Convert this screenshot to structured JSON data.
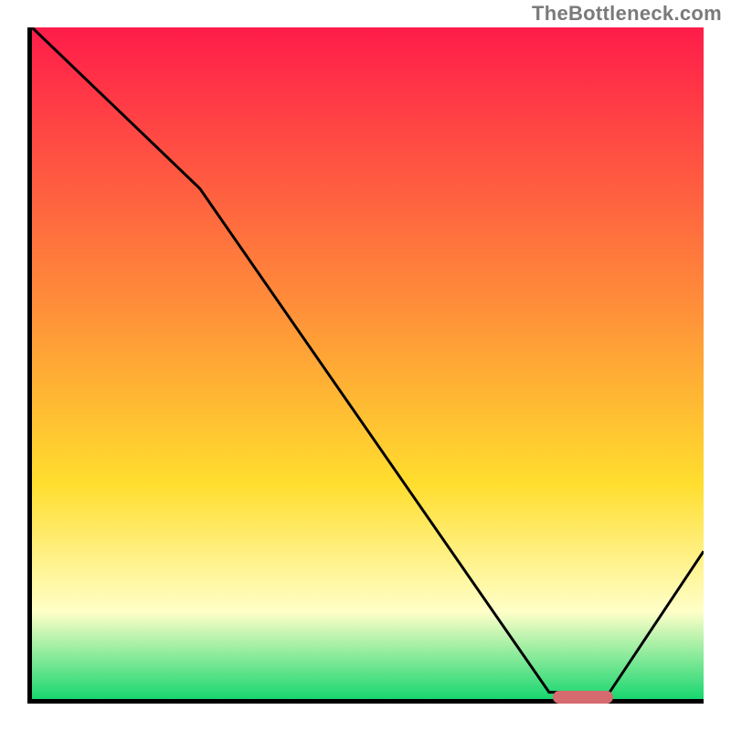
{
  "attribution": "TheBottleneck.com",
  "colors": {
    "top": "#ff1c4a",
    "mid_upper": "#ff8a3a",
    "mid": "#ffde2e",
    "pale": "#ffffc8",
    "bottom": "#18d66f",
    "curve": "#000000",
    "marker": "#d66b6f",
    "axis": "#000000"
  },
  "chart_data": {
    "type": "line",
    "title": "",
    "xlabel": "",
    "ylabel": "",
    "xlim": [
      0,
      100
    ],
    "ylim": [
      0,
      100
    ],
    "x": [
      0,
      25,
      77,
      86,
      100
    ],
    "values": [
      100,
      76,
      1,
      1,
      22
    ],
    "annotations": [
      {
        "kind": "marker-bar",
        "x_start": 77,
        "x_end": 86,
        "y": 1
      }
    ]
  }
}
